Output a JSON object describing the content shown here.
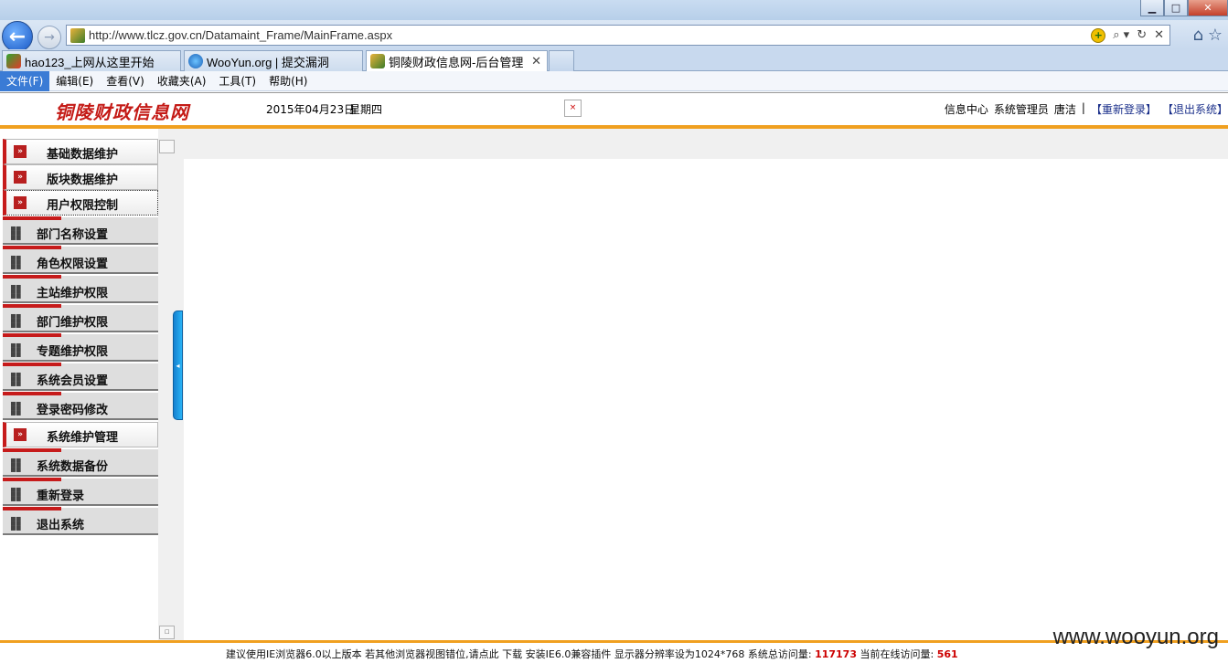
{
  "browser": {
    "url": "http://www.tlcz.gov.cn/Datamaint_Frame/MainFrame.aspx",
    "tabs": [
      {
        "label": "hao123_上网从这里开始",
        "active": false
      },
      {
        "label": "WooYun.org | 提交漏洞",
        "active": false
      },
      {
        "label": "铜陵财政信息网-后台管理",
        "active": true
      }
    ],
    "tab_close": "✕",
    "menu": [
      "文件(F)",
      "编辑(E)",
      "查看(V)",
      "收藏夹(A)",
      "工具(T)",
      "帮助(H)"
    ],
    "window_controls": {
      "minimize": "▁",
      "maximize": "□",
      "close": "✕"
    },
    "back": "←",
    "forward": "→",
    "search": "⌕ ▾",
    "refresh": "↻",
    "stop": "✕",
    "home": "⌂",
    "favorites": "☆"
  },
  "header": {
    "site_title": "铜陵财政信息网",
    "date": "2015年04月23日",
    "weekday": "星期四",
    "links": [
      "信息中心",
      "系统管理员",
      "唐洁",
      "|",
      "【重新登录】",
      "【退出系统】"
    ]
  },
  "sidebar": {
    "groups": [
      {
        "label": "基础数据维护",
        "items": []
      },
      {
        "label": "版块数据维护",
        "items": []
      },
      {
        "label": "用户权限控制",
        "items": [
          "部门名称设置",
          "角色权限设置",
          "主站维护权限",
          "部门维护权限",
          "专题维护权限",
          "系统会员设置",
          "登录密码修改"
        ]
      },
      {
        "label": "系统维护管理",
        "items": [
          "系统数据备份",
          "重新登录",
          "退出系统"
        ]
      }
    ]
  },
  "footer": {
    "text_before": "建议使用IE浏览器6.0以上版本 若其他浏览器视图错位,请点此 下载 安装IE6.0兼容插件 显示器分辨率设为1024*768 系统总访问量:",
    "total_visits": "117173",
    "online_label": "当前在线访问量:",
    "online_visits": "561",
    "watermark": "www.wooyun.org"
  },
  "colors": {
    "accent_red": "#c61b1b",
    "orange_rule": "#f0a020",
    "title_red": "#c41a16",
    "splitter_blue": "#1e9be5"
  }
}
